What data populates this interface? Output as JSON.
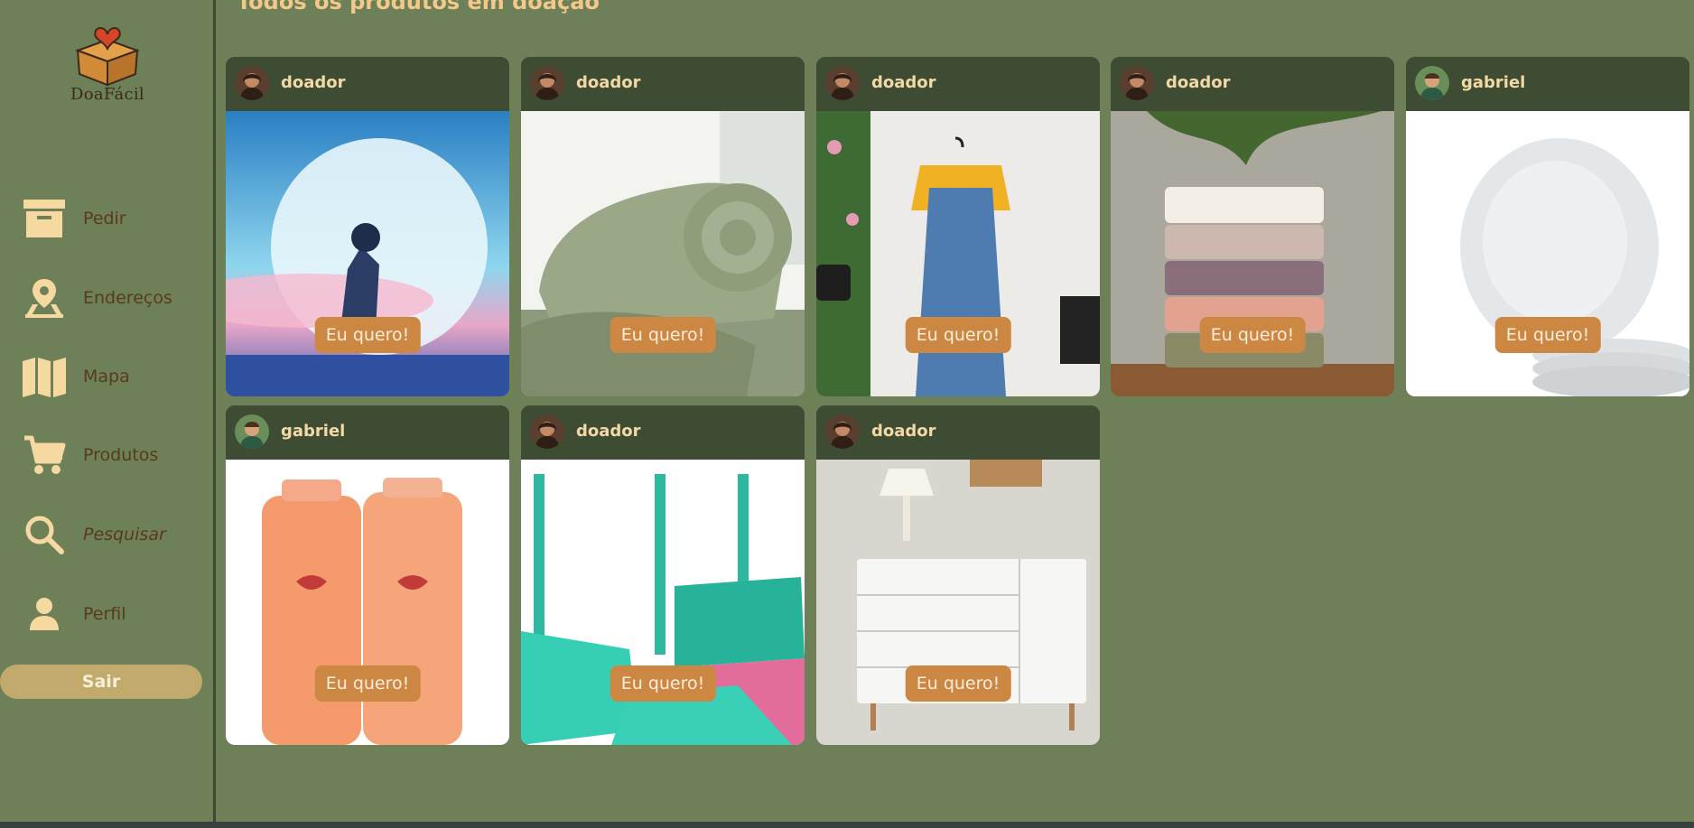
{
  "app": {
    "logo_text": "DoaFácil"
  },
  "page_title": "Todos os produtos em doação",
  "sidebar": {
    "items": [
      {
        "label": "Pedir",
        "icon": "box-icon"
      },
      {
        "label": "Endereços",
        "icon": "location-map-icon"
      },
      {
        "label": "Mapa",
        "icon": "map-icon"
      },
      {
        "label": "Produtos",
        "icon": "cart-icon"
      },
      {
        "label": "Pesquisar",
        "icon": "search-icon"
      },
      {
        "label": "Perfil",
        "icon": "person-icon"
      }
    ],
    "logout_label": "Sair"
  },
  "products": [
    {
      "user": "doador",
      "button": "Eu quero!",
      "image": "anime-warrior-moon"
    },
    {
      "user": "doador",
      "button": "Eu quero!",
      "image": "green-blanket"
    },
    {
      "user": "doador",
      "button": "Eu quero!",
      "image": "denim-dress"
    },
    {
      "user": "doador",
      "button": "Eu quero!",
      "image": "folded-towels"
    },
    {
      "user": "gabriel",
      "button": "Eu quero!",
      "image": "white-plates"
    },
    {
      "user": "gabriel",
      "button": "Eu quero!",
      "image": "shampoo-conditioner"
    },
    {
      "user": "doador",
      "button": "Eu quero!",
      "image": "broom-dustpan"
    },
    {
      "user": "doador",
      "button": "Eu quero!",
      "image": "white-dresser"
    }
  ],
  "colors": {
    "background": "#6e8058",
    "card_header": "#3f4c34",
    "button": "#cc8743",
    "logout": "#c2aa6d",
    "nav_text": "#5a3a1f",
    "nav_icon": "#f5d9a0"
  }
}
